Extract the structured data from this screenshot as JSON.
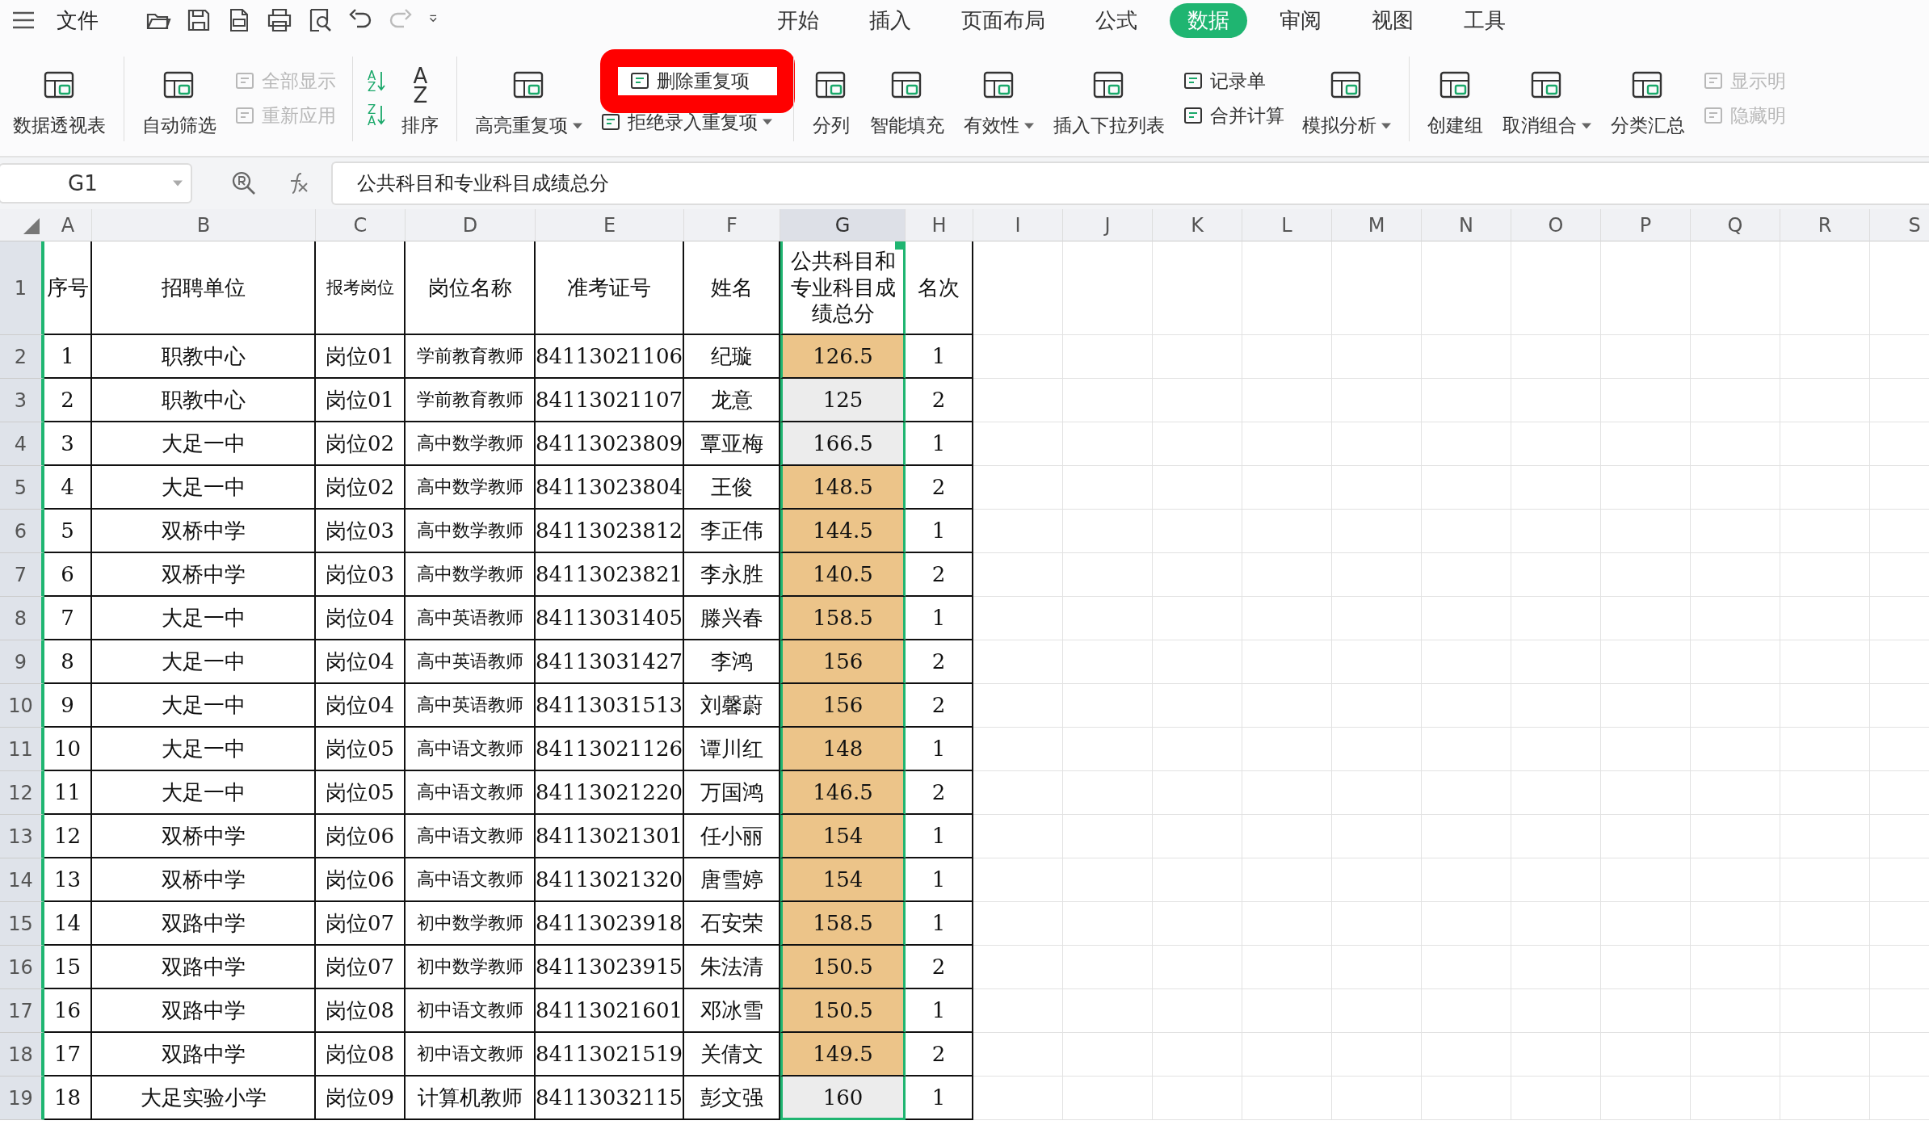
{
  "menu": {
    "file_label": "文件",
    "quick_access": [
      {
        "disabled": false
      },
      {
        "disabled": false
      },
      {
        "disabled": false
      },
      {
        "disabled": false
      },
      {
        "disabled": false
      },
      {
        "disabled": false
      },
      {
        "disabled": true
      },
      {
        "disabled": false
      }
    ],
    "tabs": [
      {
        "label": "开始",
        "selected": false
      },
      {
        "label": "插入",
        "selected": false
      },
      {
        "label": "页面布局",
        "selected": false
      },
      {
        "label": "公式",
        "selected": false
      },
      {
        "label": "数据",
        "selected": true
      },
      {
        "label": "审阅",
        "selected": false
      },
      {
        "label": "视图",
        "selected": false
      },
      {
        "label": "工具",
        "selected": false
      }
    ]
  },
  "ribbon": [
    {
      "kind": "large",
      "label": "数据透视表",
      "dropdown": false
    },
    {
      "kind": "separator"
    },
    {
      "kind": "large",
      "label": "自动筛选",
      "dropdown": false
    },
    {
      "kind": "stack",
      "items": [
        {
          "label": "全部显示",
          "disabled": true,
          "dropdown": false,
          "highlighted": false
        },
        {
          "label": "重新应用",
          "disabled": true,
          "dropdown": false,
          "highlighted": false
        }
      ]
    },
    {
      "kind": "separator"
    },
    {
      "kind": "sort_buttons",
      "items": [
        {
          "top": "A",
          "bottom": "Z"
        },
        {
          "top": "Z",
          "bottom": "A"
        }
      ]
    },
    {
      "kind": "large",
      "label": "排序",
      "dropdown": false,
      "glyph": [
        "A",
        "Z"
      ]
    },
    {
      "kind": "separator"
    },
    {
      "kind": "large",
      "label": "高亮重复项",
      "dropdown": true
    },
    {
      "kind": "stack",
      "items": [
        {
          "label": "删除重复项",
          "disabled": false,
          "dropdown": false,
          "highlighted": true
        },
        {
          "label": "拒绝录入重复项",
          "disabled": false,
          "dropdown": true,
          "highlighted": false
        }
      ]
    },
    {
      "kind": "separator"
    },
    {
      "kind": "large",
      "label": "分列",
      "dropdown": false
    },
    {
      "kind": "large",
      "label": "智能填充",
      "dropdown": false
    },
    {
      "kind": "large",
      "label": "有效性",
      "dropdown": true
    },
    {
      "kind": "large",
      "label": "插入下拉列表",
      "dropdown": false
    },
    {
      "kind": "stack",
      "items": [
        {
          "label": "记录单",
          "disabled": false,
          "dropdown": false,
          "highlighted": false
        },
        {
          "label": "合并计算",
          "disabled": false,
          "dropdown": false,
          "highlighted": false
        }
      ]
    },
    {
      "kind": "large",
      "label": "模拟分析",
      "dropdown": true
    },
    {
      "kind": "separator"
    },
    {
      "kind": "large",
      "label": "创建组",
      "dropdown": false
    },
    {
      "kind": "large",
      "label": "取消组合",
      "dropdown": true
    },
    {
      "kind": "large",
      "label": "分类汇总",
      "dropdown": false
    },
    {
      "kind": "stack",
      "items": [
        {
          "label": "显示明",
          "disabled": true,
          "dropdown": false,
          "highlighted": false
        },
        {
          "label": "隐藏明",
          "disabled": true,
          "dropdown": false,
          "highlighted": false
        }
      ]
    }
  ],
  "formula_bar": {
    "cell_ref": "G1",
    "formula": "公共科目和专业科目成绩总分"
  },
  "sheet": {
    "columns": [
      {
        "label": "A",
        "selected": false
      },
      {
        "label": "B",
        "selected": false
      },
      {
        "label": "C",
        "selected": false
      },
      {
        "label": "D",
        "selected": false
      },
      {
        "label": "E",
        "selected": false
      },
      {
        "label": "F",
        "selected": false
      },
      {
        "label": "G",
        "selected": true
      },
      {
        "label": "H",
        "selected": false
      },
      {
        "label": "I",
        "selected": false
      },
      {
        "label": "J",
        "selected": false
      },
      {
        "label": "K",
        "selected": false
      },
      {
        "label": "L",
        "selected": false
      },
      {
        "label": "M",
        "selected": false
      },
      {
        "label": "N",
        "selected": false
      },
      {
        "label": "O",
        "selected": false
      },
      {
        "label": "P",
        "selected": false
      },
      {
        "label": "Q",
        "selected": false
      },
      {
        "label": "R",
        "selected": false
      },
      {
        "label": "S",
        "selected": false
      }
    ],
    "header_row": {
      "row": "1",
      "cells": [
        "序号",
        "招聘单位",
        "报考岗位",
        "岗位名称",
        "准考证号",
        "姓名",
        "公共科目和专业科目成绩总分",
        "名次"
      ]
    },
    "rows": [
      {
        "row": "2",
        "cells": [
          "1",
          "职教中心",
          "岗位01",
          "学前教育教师",
          "84113021106",
          "纪璇",
          "126.5",
          "1"
        ],
        "score_highlight": true
      },
      {
        "row": "3",
        "cells": [
          "2",
          "职教中心",
          "岗位01",
          "学前教育教师",
          "84113021107",
          "龙意",
          "125",
          "2"
        ],
        "score_highlight": false
      },
      {
        "row": "4",
        "cells": [
          "3",
          "大足一中",
          "岗位02",
          "高中数学教师",
          "84113023809",
          "覃亚梅",
          "166.5",
          "1"
        ],
        "score_highlight": false
      },
      {
        "row": "5",
        "cells": [
          "4",
          "大足一中",
          "岗位02",
          "高中数学教师",
          "84113023804",
          "王俊",
          "148.5",
          "2"
        ],
        "score_highlight": true
      },
      {
        "row": "6",
        "cells": [
          "5",
          "双桥中学",
          "岗位03",
          "高中数学教师",
          "84113023812",
          "李正伟",
          "144.5",
          "1"
        ],
        "score_highlight": true
      },
      {
        "row": "7",
        "cells": [
          "6",
          "双桥中学",
          "岗位03",
          "高中数学教师",
          "84113023821",
          "李永胜",
          "140.5",
          "2"
        ],
        "score_highlight": true
      },
      {
        "row": "8",
        "cells": [
          "7",
          "大足一中",
          "岗位04",
          "高中英语教师",
          "84113031405",
          "滕兴春",
          "158.5",
          "1"
        ],
        "score_highlight": true
      },
      {
        "row": "9",
        "cells": [
          "8",
          "大足一中",
          "岗位04",
          "高中英语教师",
          "84113031427",
          "李鸿",
          "156",
          "2"
        ],
        "score_highlight": true
      },
      {
        "row": "10",
        "cells": [
          "9",
          "大足一中",
          "岗位04",
          "高中英语教师",
          "84113031513",
          "刘馨蔚",
          "156",
          "2"
        ],
        "score_highlight": true
      },
      {
        "row": "11",
        "cells": [
          "10",
          "大足一中",
          "岗位05",
          "高中语文教师",
          "84113021126",
          "谭川红",
          "148",
          "1"
        ],
        "score_highlight": true
      },
      {
        "row": "12",
        "cells": [
          "11",
          "大足一中",
          "岗位05",
          "高中语文教师",
          "84113021220",
          "万国鸿",
          "146.5",
          "2"
        ],
        "score_highlight": true
      },
      {
        "row": "13",
        "cells": [
          "12",
          "双桥中学",
          "岗位06",
          "高中语文教师",
          "84113021301",
          "任小丽",
          "154",
          "1"
        ],
        "score_highlight": true
      },
      {
        "row": "14",
        "cells": [
          "13",
          "双桥中学",
          "岗位06",
          "高中语文教师",
          "84113021320",
          "唐雪婷",
          "154",
          "1"
        ],
        "score_highlight": true
      },
      {
        "row": "15",
        "cells": [
          "14",
          "双路中学",
          "岗位07",
          "初中数学教师",
          "84113023918",
          "石安荣",
          "158.5",
          "1"
        ],
        "score_highlight": true
      },
      {
        "row": "16",
        "cells": [
          "15",
          "双路中学",
          "岗位07",
          "初中数学教师",
          "84113023915",
          "朱法清",
          "150.5",
          "2"
        ],
        "score_highlight": true
      },
      {
        "row": "17",
        "cells": [
          "16",
          "双路中学",
          "岗位08",
          "初中语文教师",
          "84113021601",
          "邓冰雪",
          "150.5",
          "1"
        ],
        "score_highlight": true
      },
      {
        "row": "18",
        "cells": [
          "17",
          "双路中学",
          "岗位08",
          "初中语文教师",
          "84113021519",
          "关倩文",
          "149.5",
          "2"
        ],
        "score_highlight": true
      },
      {
        "row": "19",
        "cells": [
          "18",
          "大足实验小学",
          "岗位09",
          "计算机教师",
          "84113032115",
          "彭文强",
          "160",
          "1"
        ],
        "score_highlight": false
      }
    ]
  }
}
